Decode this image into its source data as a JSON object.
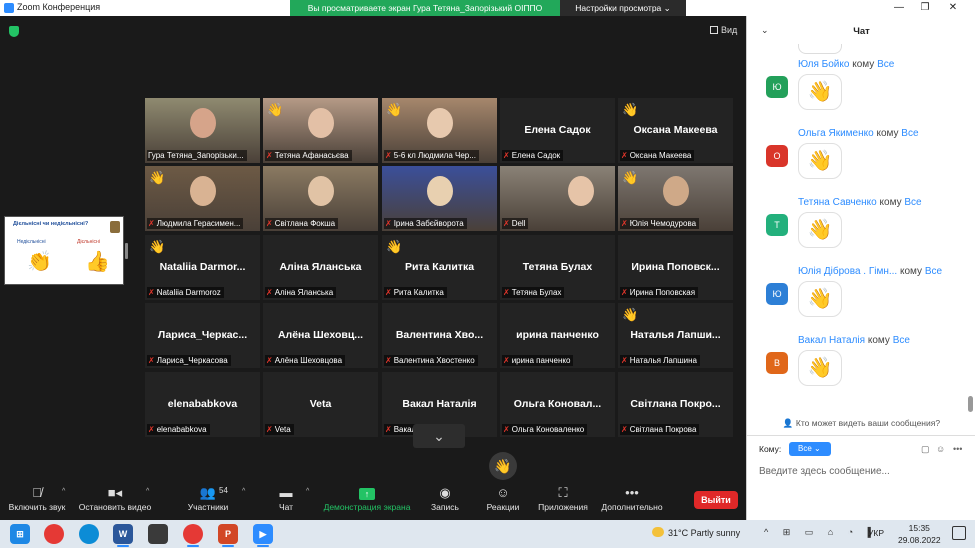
{
  "window": {
    "title": "Zoom Конференция",
    "share_banner": "Вы просматриваете экран Гура Тетяна_Запорізький ОІППО",
    "view_options": "Настройки просмотра",
    "view_button": "Вид"
  },
  "shared_thumb": {
    "title": "Дієльнісні чи недієльнісні?",
    "left": "Недієльнісні",
    "right": "Дієльнісні"
  },
  "tiles": [
    {
      "name": "Гура Тетяна_Запорізьки...",
      "big": "",
      "muted": false,
      "hand": false,
      "video": true,
      "active": true
    },
    {
      "name": "Тетяна Афанасьєва",
      "big": "",
      "muted": true,
      "hand": true,
      "video": true
    },
    {
      "name": "5-6 кл Людмила Чер...",
      "big": "",
      "muted": true,
      "hand": true,
      "video": true
    },
    {
      "name": "Елена Садок",
      "big": "Елена Садок",
      "muted": true,
      "hand": false,
      "video": false
    },
    {
      "name": "Оксана Макеева",
      "big": "Оксана Макеева",
      "muted": true,
      "hand": true,
      "video": false
    },
    {
      "name": "Людмила Герасимен...",
      "big": "",
      "muted": true,
      "hand": true,
      "video": true
    },
    {
      "name": "Світлана Фокша",
      "big": "",
      "muted": true,
      "hand": false,
      "video": true
    },
    {
      "name": "Ірина Забєйворота",
      "big": "",
      "muted": true,
      "hand": false,
      "video": true
    },
    {
      "name": "Dell",
      "big": "",
      "muted": true,
      "hand": false,
      "video": true
    },
    {
      "name": "Юлія Чемодурова",
      "big": "",
      "muted": true,
      "hand": true,
      "video": true
    },
    {
      "name": "Nataliia Darmoroz",
      "big": "Nataliia Darmor...",
      "muted": true,
      "hand": true,
      "video": false
    },
    {
      "name": "Аліна Яланська",
      "big": "Аліна Яланська",
      "muted": true,
      "hand": false,
      "video": false
    },
    {
      "name": "Рита Калитка",
      "big": "Рита Калитка",
      "muted": true,
      "hand": true,
      "video": false
    },
    {
      "name": "Тетяна Булах",
      "big": "Тетяна Булах",
      "muted": true,
      "hand": false,
      "video": false
    },
    {
      "name": "Ирина Поповская",
      "big": "Ирина Поповск...",
      "muted": true,
      "hand": false,
      "video": false
    },
    {
      "name": "Лариса_Черкасова",
      "big": "Лариса_Черкас...",
      "muted": true,
      "hand": false,
      "video": false
    },
    {
      "name": "Алёна Шеховцова",
      "big": "Алёна Шеховц...",
      "muted": true,
      "hand": false,
      "video": false
    },
    {
      "name": "Валентина Хвостенко",
      "big": "Валентина Хво...",
      "muted": true,
      "hand": false,
      "video": false
    },
    {
      "name": "ирина панченко",
      "big": "ирина панченко",
      "muted": true,
      "hand": false,
      "video": false
    },
    {
      "name": "Наталья Лапшина",
      "big": "Наталья Лапши...",
      "muted": true,
      "hand": true,
      "video": false
    },
    {
      "name": "elenababkova",
      "big": "elenababkova",
      "muted": true,
      "hand": false,
      "video": false
    },
    {
      "name": "Veta",
      "big": "Veta",
      "muted": true,
      "hand": false,
      "video": false
    },
    {
      "name": "Вакал Наталія",
      "big": "Вакал Наталія",
      "muted": true,
      "hand": false,
      "video": false
    },
    {
      "name": "Ольга Коноваленко",
      "big": "Ольга Коновал...",
      "muted": true,
      "hand": false,
      "video": false
    },
    {
      "name": "Світлана Покрова",
      "big": "Світлана Покро...",
      "muted": true,
      "hand": false,
      "video": false
    }
  ],
  "toolbar": {
    "mute": "Включить звук",
    "video": "Остановить видео",
    "participants": "Участники",
    "participants_count": "54",
    "chat": "Чат",
    "share": "Демонстрация экрана",
    "record": "Запись",
    "reactions": "Реакции",
    "apps": "Приложения",
    "more": "Дополнительно",
    "leave": "Выйти"
  },
  "chat": {
    "title": "Чат",
    "to_word": "кому",
    "all_word": "Все",
    "messages": [
      {
        "sender": "Юля Бойко",
        "initial": "Ю",
        "color": "#23a05a"
      },
      {
        "sender": "Ольга Якименко",
        "initial": "О",
        "color": "#d9352a"
      },
      {
        "sender": "Тетяна Савченко",
        "initial": "Т",
        "color": "#23b07c"
      },
      {
        "sender": "Юлія Діброва . Гімн...",
        "initial": "Ю",
        "color": "#2d7fd6"
      },
      {
        "sender": "Вакал Наталія",
        "initial": "В",
        "color": "#e0671a"
      }
    ],
    "who_sees": "Кто может видеть ваши сообщения?",
    "to_label": "Кому:",
    "to_value": "Все",
    "placeholder": "Введите здесь сообщение..."
  },
  "taskbar": {
    "weather": "31°C  Partly sunny",
    "lang": "УКР",
    "time": "15:35",
    "date": "29.08.2022"
  }
}
